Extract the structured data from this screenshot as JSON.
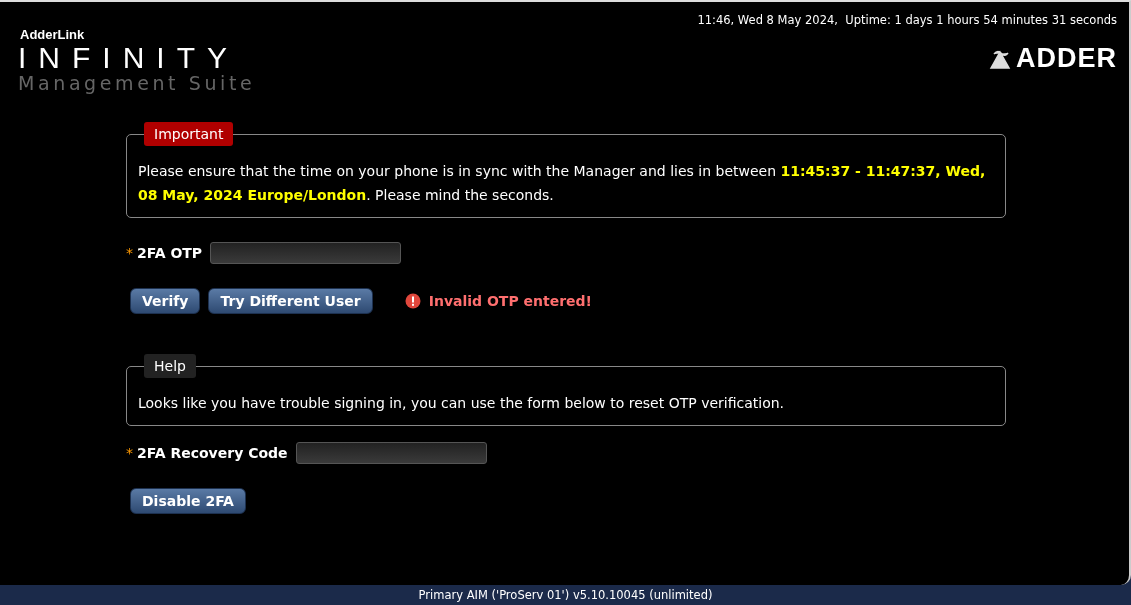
{
  "header": {
    "logo": {
      "brand": "AdderLink",
      "product": "INFINITY",
      "subtitle": "Management Suite"
    },
    "clock": "11:46, Wed 8 May 2024,  Uptime: 1 days 1 hours 54 minutes 31 seconds",
    "vendor_logo": "ADDER"
  },
  "important": {
    "legend": "Important",
    "message": "Please ensure that the time on your phone is in sync with the Manager and lies in between **11:45:37 - 11:47:37, Wed, 08 May, 2024 Europe/London**. Please mind the seconds."
  },
  "otp_field": {
    "label": "2FA OTP",
    "required_mark": "*"
  },
  "buttons": [
    "Verify",
    "Try Different User"
  ],
  "error": {
    "text": "Invalid OTP entered!"
  },
  "help": {
    "legend": "Help",
    "message": "Looks like you have trouble signing in, you can use the form below to reset OTP verification."
  },
  "recovery_field": {
    "label": "2FA Recovery Code",
    "required_mark": "*"
  },
  "recovery_button": "Disable 2FA",
  "status_bar": "Primary AIM ('ProServ 01') v5.10.10045 (unlimited)"
}
